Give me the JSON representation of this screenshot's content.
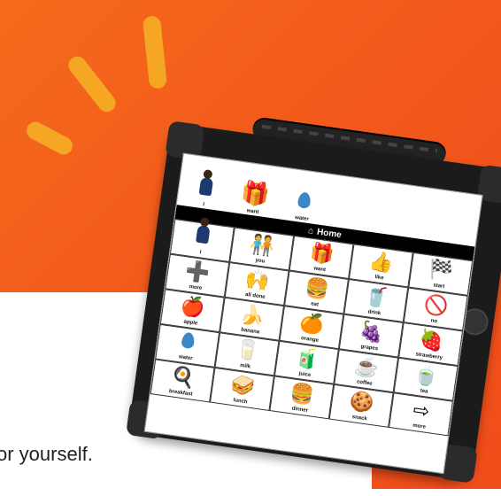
{
  "tagline": "or yourself.",
  "screen": {
    "message_bar": [
      {
        "icon": "person-icon",
        "label": "I"
      },
      {
        "icon": "want-icon",
        "label": "want"
      },
      {
        "icon": "water-drop-icon",
        "label": "water"
      }
    ],
    "title_icon": "home-icon",
    "title": "Home",
    "grid": [
      {
        "icon": "person-icon",
        "label": "I",
        "glyph": ""
      },
      {
        "icon": "you-icon",
        "label": "you",
        "glyph": "🧑‍🤝‍🧑"
      },
      {
        "icon": "want-icon",
        "label": "want",
        "glyph": "🎁"
      },
      {
        "icon": "like-icon",
        "label": "like",
        "glyph": "👍"
      },
      {
        "icon": "start-flag-icon",
        "label": "start",
        "glyph": "🏁"
      },
      {
        "icon": "more-icon",
        "label": "more",
        "glyph": "➕"
      },
      {
        "icon": "all-done-icon",
        "label": "all done",
        "glyph": "🙌"
      },
      {
        "icon": "eat-icon",
        "label": "eat",
        "glyph": "🍔"
      },
      {
        "icon": "drink-icon",
        "label": "drink",
        "glyph": "🥤"
      },
      {
        "icon": "no-icon",
        "label": "no",
        "glyph": "🚫"
      },
      {
        "icon": "apple-icon",
        "label": "apple",
        "glyph": "🍎"
      },
      {
        "icon": "banana-icon",
        "label": "banana",
        "glyph": "🍌"
      },
      {
        "icon": "orange-icon",
        "label": "orange",
        "glyph": "🍊"
      },
      {
        "icon": "grapes-icon",
        "label": "grapes",
        "glyph": "🍇"
      },
      {
        "icon": "strawberry-icon",
        "label": "strawberry",
        "glyph": "🍓"
      },
      {
        "icon": "water-drop-icon",
        "label": "water",
        "glyph": ""
      },
      {
        "icon": "milk-icon",
        "label": "milk",
        "glyph": "🥛"
      },
      {
        "icon": "juice-icon",
        "label": "juice",
        "glyph": "🧃"
      },
      {
        "icon": "coffee-icon",
        "label": "coffee",
        "glyph": "☕"
      },
      {
        "icon": "tea-icon",
        "label": "tea",
        "glyph": "🍵"
      },
      {
        "icon": "breakfast-icon",
        "label": "breakfast",
        "glyph": "🍳"
      },
      {
        "icon": "lunch-icon",
        "label": "lunch",
        "glyph": "🥪"
      },
      {
        "icon": "dinner-icon",
        "label": "dinner",
        "glyph": "🍔"
      },
      {
        "icon": "snack-icon",
        "label": "snack",
        "glyph": "🍪"
      },
      {
        "icon": "more-arrow-icon",
        "label": "more",
        "glyph": "⇨"
      }
    ]
  },
  "colors": {
    "background_orange": "#f2561b",
    "ray_yellow": "#f5a623",
    "case_black": "#1b1b1b"
  }
}
